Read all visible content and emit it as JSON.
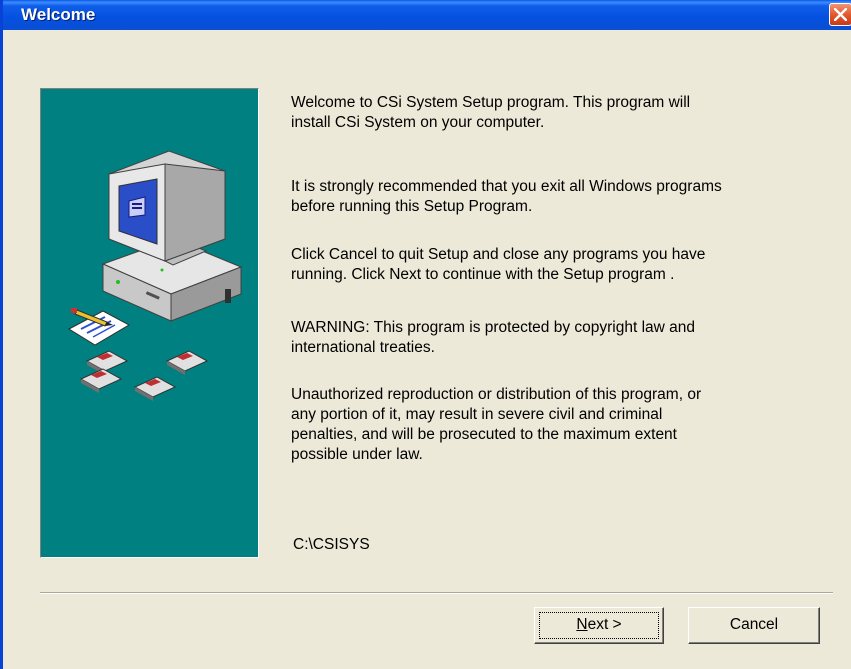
{
  "window": {
    "title": "Welcome"
  },
  "messages": [
    "Welcome to CSi System Setup program. This program will\ninstall CSi System on your computer.",
    "It is strongly recommended that you exit all Windows programs\nbefore running this Setup Program.",
    "Click Cancel to quit Setup and close any programs you have\nrunning.  Click Next to continue with the Setup program .",
    "WARNING: This program is protected by copyright law and\ninternational treaties.",
    "Unauthorized reproduction or distribution of this program, or\nany portion of it, may result in severe civil and criminal\npenalties, and will be prosecuted to the maximum extent\npossible under law."
  ],
  "install_path": "C:\\CSISYS",
  "buttons": {
    "next_mnemonic": "N",
    "next_rest": "ext >",
    "cancel": "Cancel"
  },
  "colors": {
    "titlebar": "#0450e0",
    "dialog_bg": "#ece9d8",
    "panel_teal": "#008080",
    "close_red": "#e35a2e"
  },
  "icons": [
    "close-icon",
    "computer-icon",
    "notepad-pencil-icon",
    "floppy-disk-icon"
  ]
}
